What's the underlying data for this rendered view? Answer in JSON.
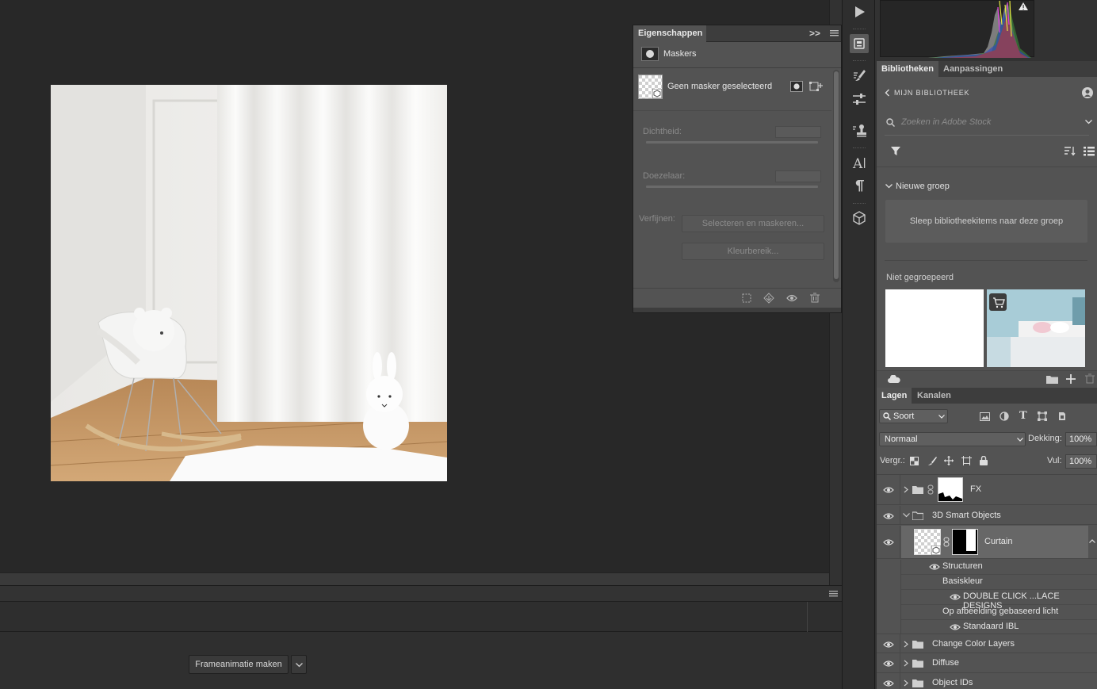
{
  "properties_panel": {
    "tab_title": "Eigenschappen",
    "section_title": "Maskers",
    "mask_status": "Geen masker geselecteerd",
    "density_label": "Dichtheid:",
    "feather_label": "Doezelaar:",
    "refine_label": "Verfijnen:",
    "select_mask_button": "Selecteren en maskeren...",
    "color_range_button": "Kleurbereik..."
  },
  "timeline": {
    "create_button": "Frameanimatie maken"
  },
  "libraries_panel": {
    "tabs": [
      "Bibliotheken",
      "Aanpassingen"
    ],
    "breadcrumb": "MIJN BIBLIOTHEEK",
    "search_placeholder": "Zoeken in Adobe Stock",
    "group_title": "Nieuwe groep",
    "drop_hint": "Sleep bibliotheekitems naar deze groep",
    "ungrouped_title": "Niet gegroepeerd"
  },
  "layers_panel": {
    "tabs": [
      "Lagen",
      "Kanalen"
    ],
    "filter_kind": "Soort",
    "blend_mode": "Normaal",
    "opacity_label": "Dekking:",
    "opacity_value": "100%",
    "lock_label": "Vergr.:",
    "fill_label": "Vul:",
    "fill_value": "100%",
    "layers": {
      "fx": "FX",
      "smart_objects_group": "3D Smart Objects",
      "curtain": "Curtain",
      "textures": "Structuren",
      "base_color": "Basiskleur",
      "base_color_item": "DOUBLE CLICK ...LACE DESIGNS",
      "ibl": "Op afbeelding gebaseerd licht",
      "ibl_item": "Standaard IBL",
      "change_color": "Change Color Layers",
      "diffuse": "Diffuse",
      "object_ids": "Object IDs"
    }
  },
  "colors": {
    "app_bg": "#282828",
    "panel_bg": "#535353",
    "selected_layer": "#676767",
    "accent_text": "#e6e6e6"
  }
}
